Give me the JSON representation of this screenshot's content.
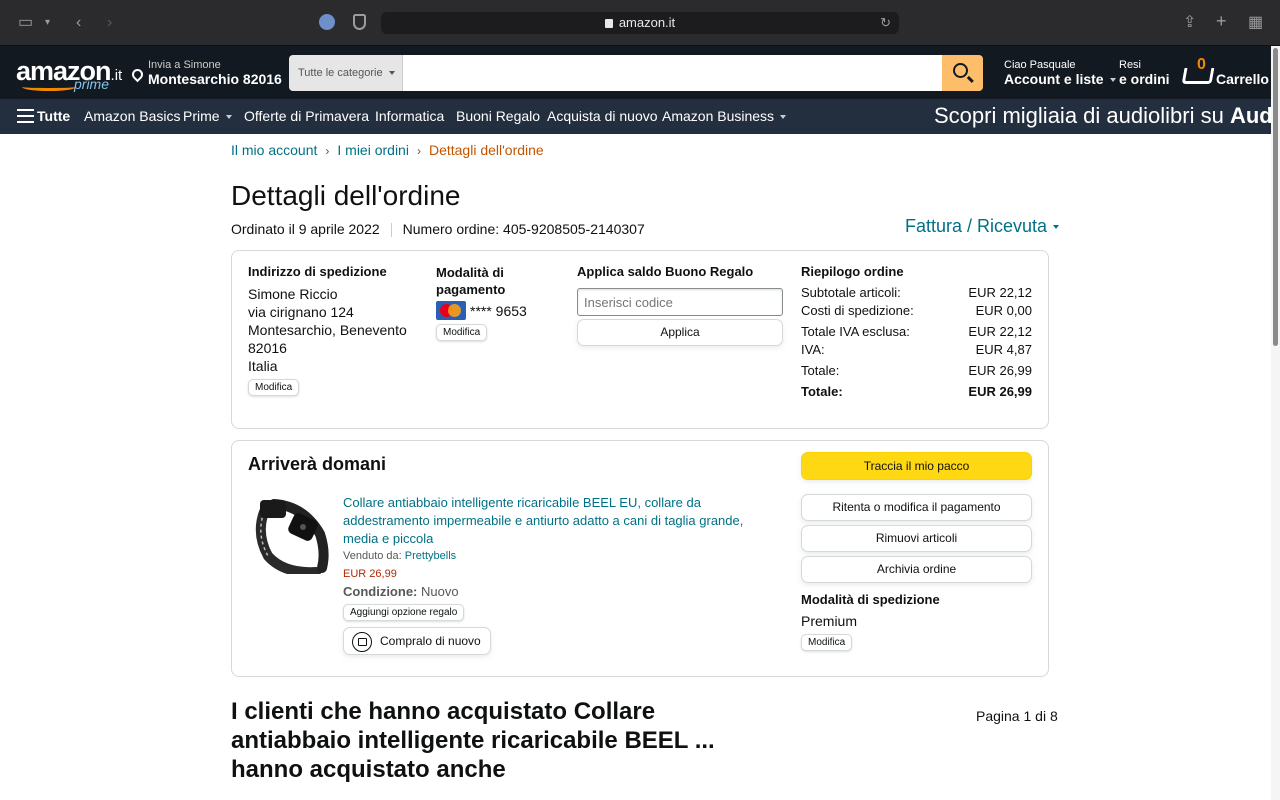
{
  "browser": {
    "url": "amazon.it"
  },
  "header": {
    "logo_text": "amazon",
    "logo_tld": ".it",
    "logo_prime": "prime",
    "deliver_line1": "Invia a Simone",
    "deliver_line2": "Montesarchio 82016",
    "search_category": "Tutte le categorie",
    "search_value": "",
    "account_line1": "Ciao Pasquale",
    "account_line2": "Account e liste",
    "orders_line1": "Resi",
    "orders_line2": "e ordini",
    "cart_count": "0",
    "cart_label": "Carrello"
  },
  "nav": {
    "all": "Tutte",
    "items": [
      "Amazon Basics",
      "Prime",
      "Offerte di Primavera",
      "Informatica",
      "Buoni Regalo",
      "Acquista di nuovo",
      "Amazon Business"
    ],
    "promo_text": "Scopri migliaia di audiolibri su",
    "promo_brand": "Audible"
  },
  "breadcrumb": {
    "items": [
      "Il mio account",
      "I miei ordini",
      "Dettagli dell'ordine"
    ]
  },
  "order": {
    "title": "Dettagli dell'ordine",
    "ordered_on": "Ordinato il 9 aprile 2022",
    "order_number": "Numero ordine: 405-9208505-2140307",
    "invoice_link": "Fattura / Ricevuta",
    "shipping": {
      "heading": "Indirizzo di spedizione",
      "lines": [
        "Simone Riccio",
        "via cirignano 124",
        "Montesarchio, Benevento",
        "82016",
        "Italia"
      ],
      "edit": "Modifica"
    },
    "payment": {
      "heading": "Modalità di pagamento",
      "card": "**** 9653",
      "edit": "Modifica"
    },
    "gift": {
      "heading": "Applica saldo Buono Regalo",
      "placeholder": "Inserisci codice",
      "apply": "Applica"
    },
    "summary": {
      "heading": "Riepilogo ordine",
      "rows": [
        {
          "label": "Subtotale articoli:",
          "value": "EUR 22,12"
        },
        {
          "label": "Costi di spedizione:",
          "value": "EUR 0,00"
        },
        {
          "label": "Totale IVA esclusa:",
          "value": "EUR 22,12"
        },
        {
          "label": "IVA:",
          "value": "EUR 4,87"
        },
        {
          "label": "Totale:",
          "value": "EUR 26,99"
        }
      ],
      "grand_label": "Totale:",
      "grand_value": "EUR 26,99"
    }
  },
  "shipment": {
    "status": "Arriverà domani",
    "product_title": "Collare antiabbaio intelligente ricaricabile BEEL EU, collare da addestramento impermeabile e antiurto adatto a cani di taglia grande, media e piccola",
    "sold_by_label": "Venduto da:",
    "seller": "Prettybells",
    "price": "EUR 26,99",
    "condition_label": "Condizione:",
    "condition": "Nuovo",
    "gift_option": "Aggiungi opzione regalo",
    "buy_again": "Compralo di nuovo",
    "track": "Traccia il mio pacco",
    "retry_payment": "Ritenta o modifica il pagamento",
    "remove_items": "Rimuovi articoli",
    "archive": "Archivia ordine",
    "ship_method_heading": "Modalità di spedizione",
    "ship_method": "Premium",
    "ship_edit": "Modifica"
  },
  "recommendations": {
    "title": "I clienti che hanno acquistato Collare antiabbaio intelligente ricaricabile BEEL ... hanno acquistato anche",
    "page": "Pagina 1 di 8"
  },
  "colors": {
    "nav_dark": "#131921",
    "nav_sub": "#232f3e",
    "link": "#007185",
    "accent_orange": "#c45500",
    "button_yellow": "#ffd814"
  }
}
